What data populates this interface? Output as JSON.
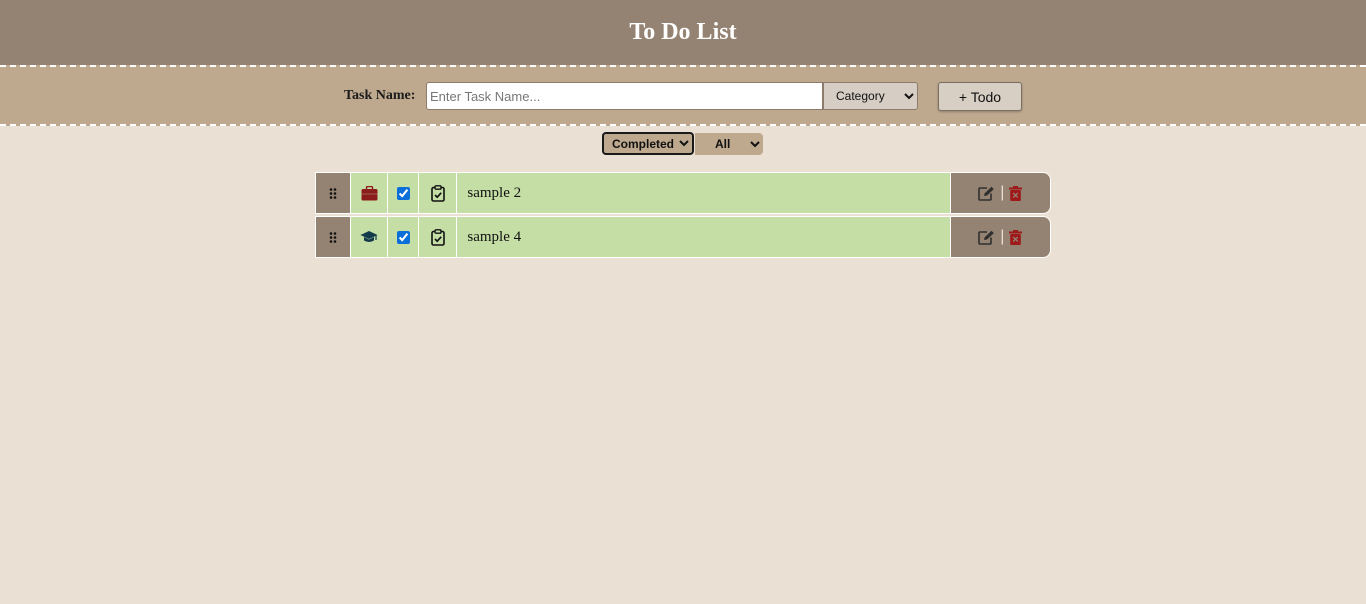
{
  "app": {
    "title": "To Do List"
  },
  "form": {
    "task_label": "Task Name:",
    "task_placeholder": "Enter Task Name...",
    "task_value": "",
    "category_selected": "Category",
    "add_button_label": "+ Todo"
  },
  "filters": {
    "status_selected": "Completed",
    "category_selected": "All"
  },
  "todos": [
    {
      "name": "sample 2",
      "category_icon": "briefcase-icon",
      "category_color": "#8b1c1c",
      "completed": true
    },
    {
      "name": "sample 4",
      "category_icon": "graduation-cap-icon",
      "category_color": "#123a4a",
      "completed": true
    }
  ],
  "colors": {
    "header_bg": "#948272",
    "form_bg": "#bea98f",
    "page_bg": "#ebe0d4",
    "row_bg": "#c5dea5",
    "delete_icon": "#9e1a1a"
  }
}
